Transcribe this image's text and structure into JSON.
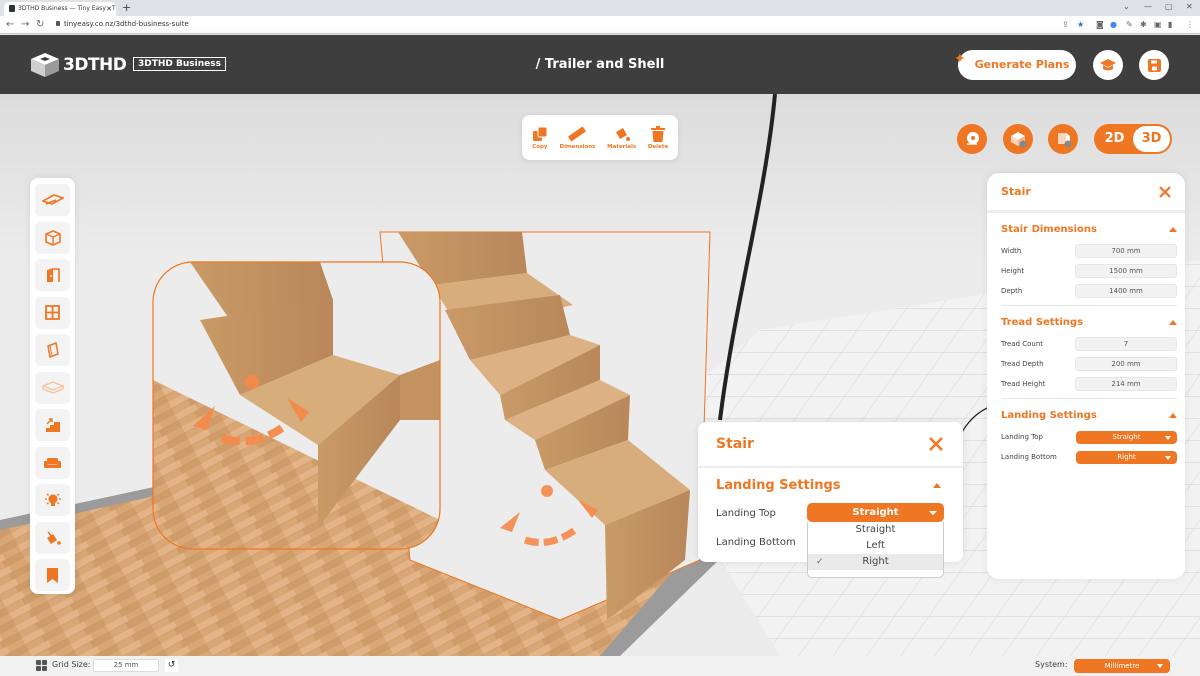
{
  "browser": {
    "tab_title": "3DTHD Business — Tiny Easy - T",
    "url": "tinyeasy.co.nz/3dthd-business-suite",
    "window_controls": [
      "⌄",
      "—",
      "▢",
      "✕"
    ]
  },
  "header": {
    "logo_text": "3DTHD",
    "badge": "3DTHD Business",
    "page_title": "/ Trailer and Shell",
    "generate_label": "Generate Plans",
    "icons": [
      "graduation-cap-icon",
      "save-icon"
    ]
  },
  "toolbar": {
    "items": [
      {
        "label": "Copy",
        "icon": "copy-icon"
      },
      {
        "label": "Dimensions",
        "icon": "ruler-icon"
      },
      {
        "label": "Materials",
        "icon": "paint-bucket-icon"
      },
      {
        "label": "Delete",
        "icon": "trash-icon"
      }
    ]
  },
  "view_controls": {
    "toggle": {
      "options": [
        "2D",
        "3D"
      ],
      "selected": "3D"
    },
    "icons": [
      "measure-tape-icon",
      "layers-hide-icon",
      "walls-hide-icon"
    ]
  },
  "sidebar": {
    "items": [
      {
        "icon": "trailer-icon"
      },
      {
        "icon": "shell-cube-icon"
      },
      {
        "icon": "door-icon"
      },
      {
        "icon": "window-icon"
      },
      {
        "icon": "wall-panel-icon"
      },
      {
        "icon": "floor-icon"
      },
      {
        "icon": "stairs-icon"
      },
      {
        "icon": "sofa-icon"
      },
      {
        "icon": "light-bulb-icon"
      },
      {
        "icon": "paint-bucket-icon"
      },
      {
        "icon": "bookmark-icon"
      }
    ]
  },
  "panel": {
    "title": "Stair",
    "sections": {
      "dimensions": {
        "title": "Stair Dimensions",
        "rows": [
          {
            "label": "Width",
            "value": "700 mm"
          },
          {
            "label": "Height",
            "value": "1500 mm"
          },
          {
            "label": "Depth",
            "value": "1400 mm"
          }
        ]
      },
      "tread": {
        "title": "Tread Settings",
        "rows": [
          {
            "label": "Tread Count",
            "value": "7"
          },
          {
            "label": "Tread Depth",
            "value": "200 mm"
          },
          {
            "label": "Tread Height",
            "value": "214 mm"
          }
        ]
      },
      "landing": {
        "title": "Landing Settings",
        "rows": [
          {
            "label": "Landing Top",
            "value": "Straight"
          },
          {
            "label": "Landing Bottom",
            "value": "Right"
          }
        ]
      }
    }
  },
  "callout": {
    "title": "Stair",
    "section": "Landing Settings",
    "landing_top_label": "Landing Top",
    "landing_bottom_label": "Landing Bottom",
    "landing_top_value": "Straight",
    "options": [
      "Straight",
      "Left",
      "Right"
    ],
    "checked_option": "Right",
    "check_mark": "✓"
  },
  "bottombar": {
    "grid_label": "Grid Size:",
    "grid_value": "25 mm",
    "system_label": "System:",
    "system_value": "Millimetre"
  },
  "colors": {
    "accent": "#ef7623",
    "header_bg": "#3e3e3e"
  }
}
